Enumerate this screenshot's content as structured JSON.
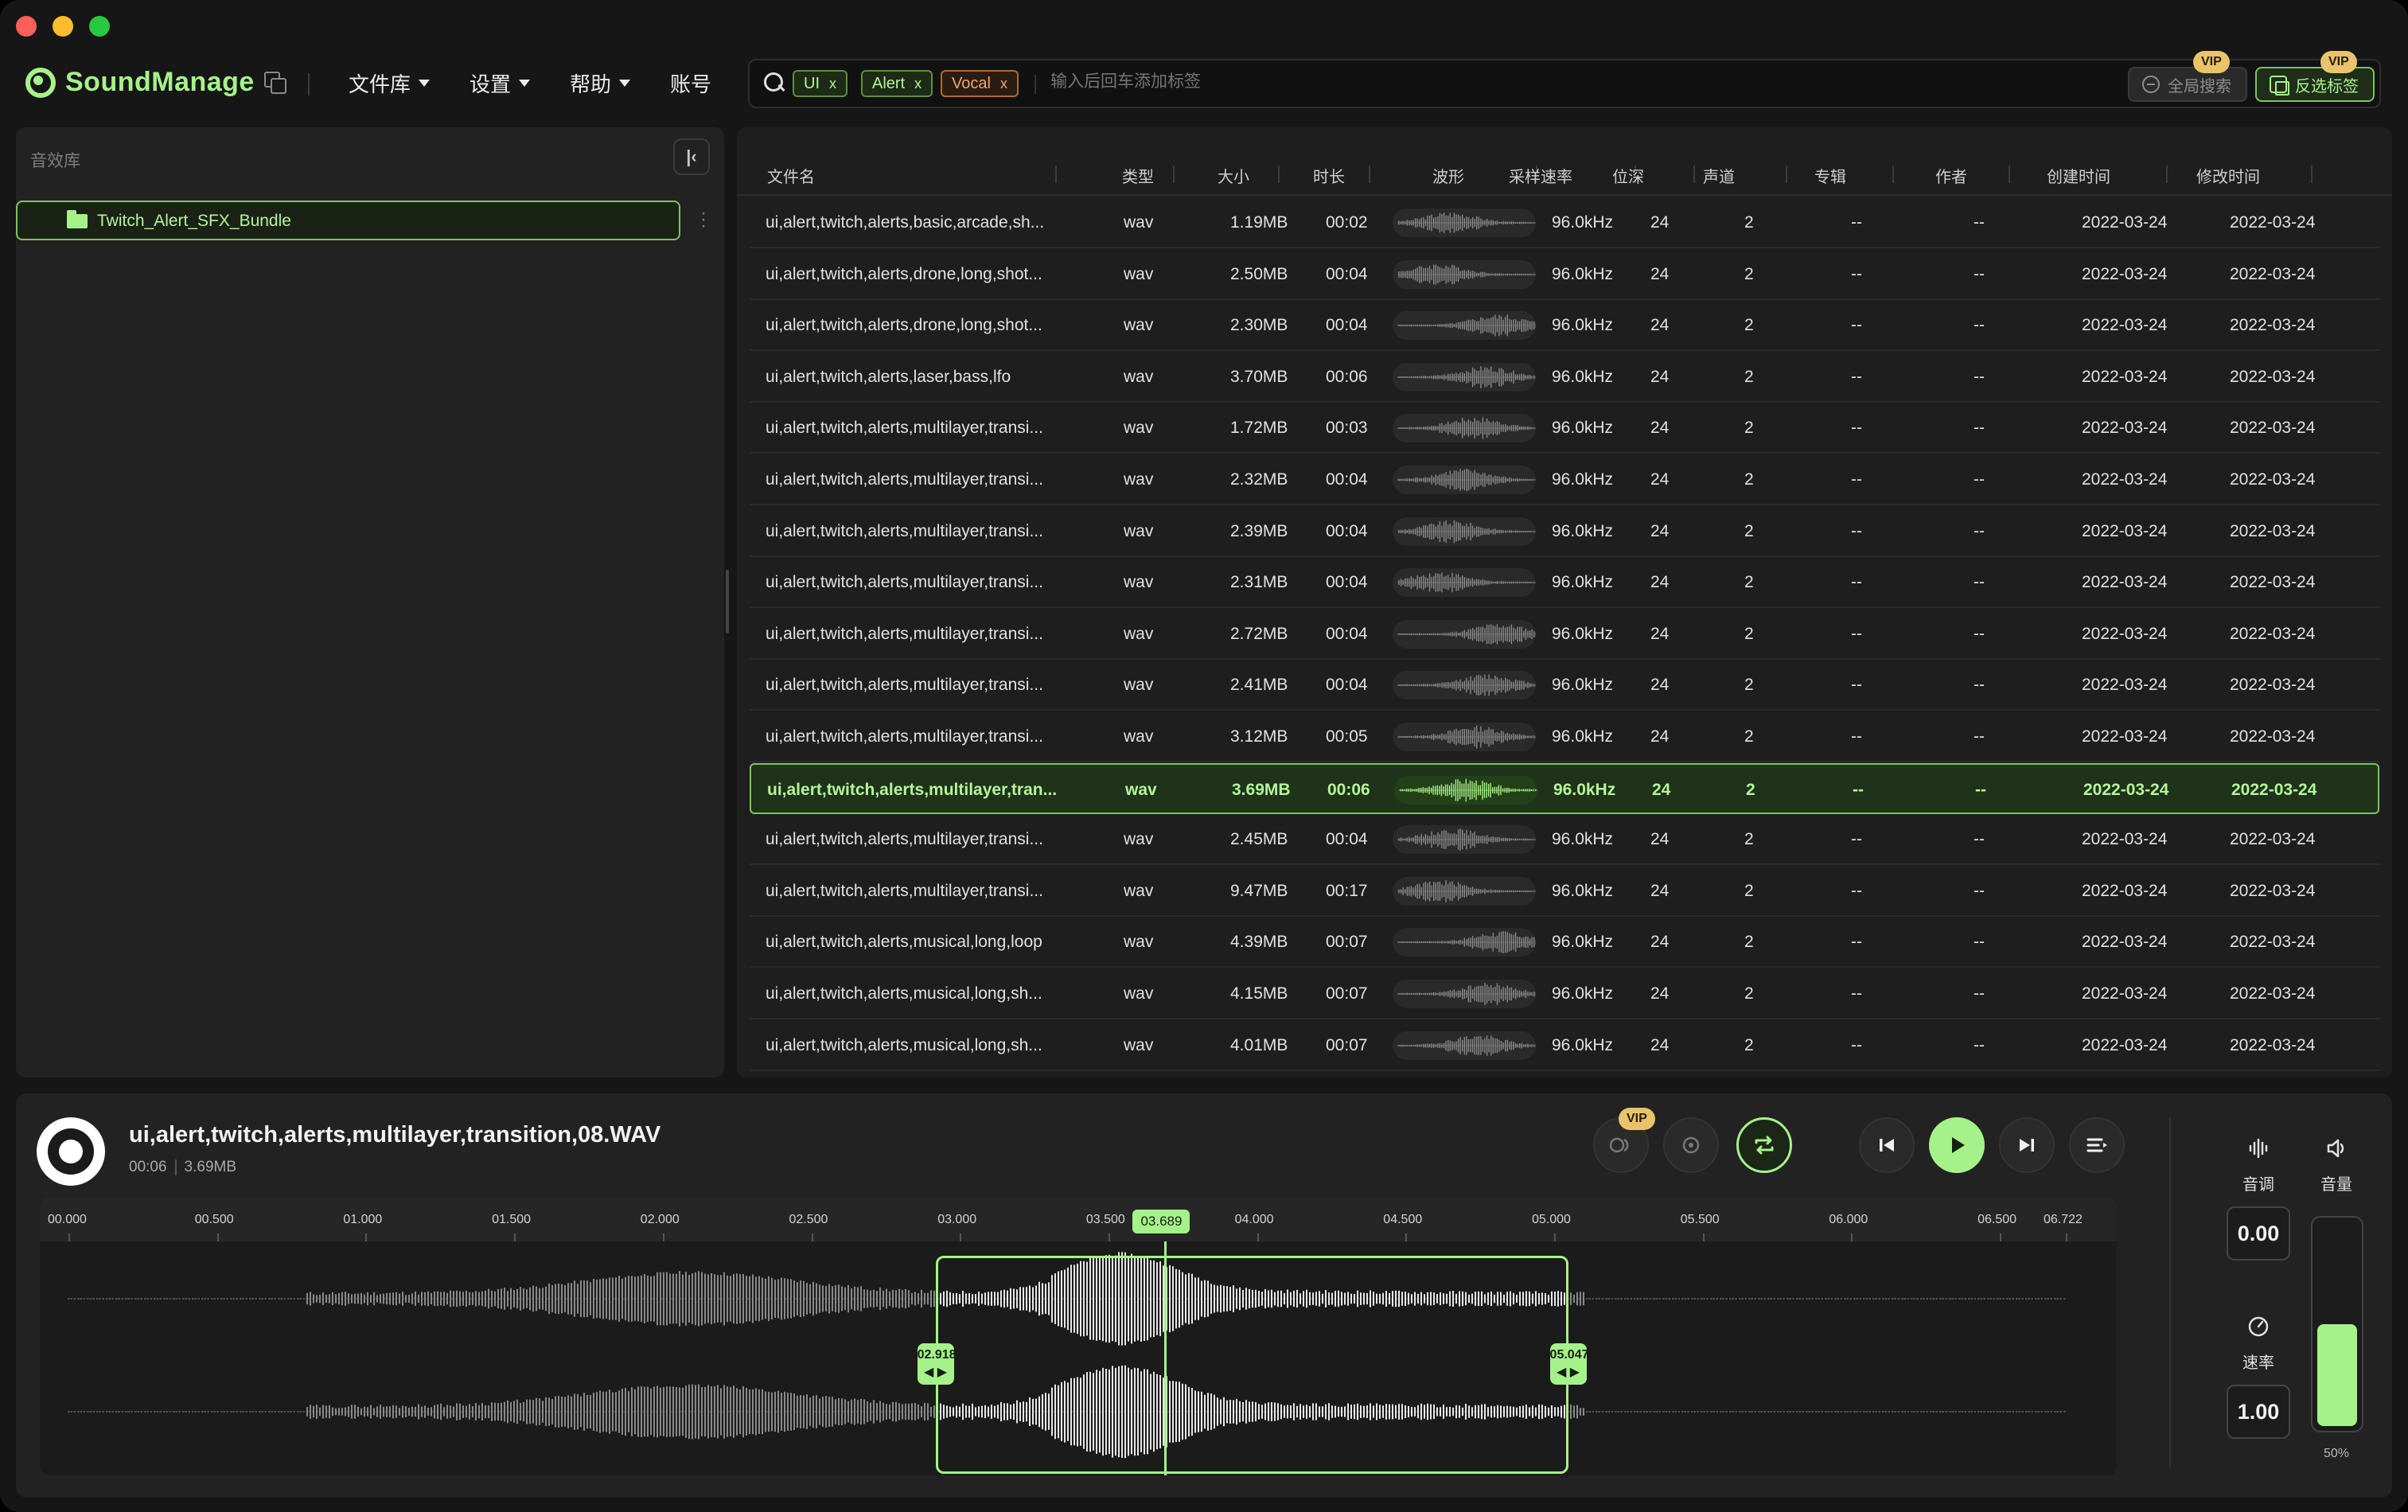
{
  "app": {
    "name": "SoundManage"
  },
  "menu": {
    "library": "文件库",
    "settings": "设置",
    "help": "帮助",
    "account": "账号"
  },
  "search": {
    "tags": [
      {
        "label": "UI",
        "x": "x",
        "color": "#b6f49a"
      },
      {
        "label": "Alert",
        "x": "x",
        "color": "#b6f49a"
      },
      {
        "label": "Vocal",
        "x": "x",
        "color": "#f2a66d"
      }
    ],
    "placeholder": "输入后回车添加标签",
    "global_search": "全局搜索",
    "invert_tags": "反选标签",
    "vip": "VIP"
  },
  "sidebar": {
    "title": "音效库",
    "folder": "Twitch_Alert_SFX_Bundle"
  },
  "table": {
    "headers": [
      "文件名",
      "类型",
      "大小",
      "时长",
      "波形",
      "采样速率",
      "位深",
      "声道",
      "专辑",
      "作者",
      "创建时间",
      "修改时间"
    ],
    "rows": [
      [
        "ui,alert,twitch,alerts,basic,arcade,sh...",
        "wav",
        "1.19MB",
        "00:02",
        "96.0kHz",
        "24",
        "2",
        "--",
        "--",
        "2022-03-24",
        "2022-03-24"
      ],
      [
        "ui,alert,twitch,alerts,drone,long,shot...",
        "wav",
        "2.50MB",
        "00:04",
        "96.0kHz",
        "24",
        "2",
        "--",
        "--",
        "2022-03-24",
        "2022-03-24"
      ],
      [
        "ui,alert,twitch,alerts,drone,long,shot...",
        "wav",
        "2.30MB",
        "00:04",
        "96.0kHz",
        "24",
        "2",
        "--",
        "--",
        "2022-03-24",
        "2022-03-24"
      ],
      [
        "ui,alert,twitch,alerts,laser,bass,lfo",
        "wav",
        "3.70MB",
        "00:06",
        "96.0kHz",
        "24",
        "2",
        "--",
        "--",
        "2022-03-24",
        "2022-03-24"
      ],
      [
        "ui,alert,twitch,alerts,multilayer,transi...",
        "wav",
        "1.72MB",
        "00:03",
        "96.0kHz",
        "24",
        "2",
        "--",
        "--",
        "2022-03-24",
        "2022-03-24"
      ],
      [
        "ui,alert,twitch,alerts,multilayer,transi...",
        "wav",
        "2.32MB",
        "00:04",
        "96.0kHz",
        "24",
        "2",
        "--",
        "--",
        "2022-03-24",
        "2022-03-24"
      ],
      [
        "ui,alert,twitch,alerts,multilayer,transi...",
        "wav",
        "2.39MB",
        "00:04",
        "96.0kHz",
        "24",
        "2",
        "--",
        "--",
        "2022-03-24",
        "2022-03-24"
      ],
      [
        "ui,alert,twitch,alerts,multilayer,transi...",
        "wav",
        "2.31MB",
        "00:04",
        "96.0kHz",
        "24",
        "2",
        "--",
        "--",
        "2022-03-24",
        "2022-03-24"
      ],
      [
        "ui,alert,twitch,alerts,multilayer,transi...",
        "wav",
        "2.72MB",
        "00:04",
        "96.0kHz",
        "24",
        "2",
        "--",
        "--",
        "2022-03-24",
        "2022-03-24"
      ],
      [
        "ui,alert,twitch,alerts,multilayer,transi...",
        "wav",
        "2.41MB",
        "00:04",
        "96.0kHz",
        "24",
        "2",
        "--",
        "--",
        "2022-03-24",
        "2022-03-24"
      ],
      [
        "ui,alert,twitch,alerts,multilayer,transi...",
        "wav",
        "3.12MB",
        "00:05",
        "96.0kHz",
        "24",
        "2",
        "--",
        "--",
        "2022-03-24",
        "2022-03-24"
      ],
      [
        "ui,alert,twitch,alerts,multilayer,tran...",
        "wav",
        "3.69MB",
        "00:06",
        "96.0kHz",
        "24",
        "2",
        "--",
        "--",
        "2022-03-24",
        "2022-03-24"
      ],
      [
        "ui,alert,twitch,alerts,multilayer,transi...",
        "wav",
        "2.45MB",
        "00:04",
        "96.0kHz",
        "24",
        "2",
        "--",
        "--",
        "2022-03-24",
        "2022-03-24"
      ],
      [
        "ui,alert,twitch,alerts,multilayer,transi...",
        "wav",
        "9.47MB",
        "00:17",
        "96.0kHz",
        "24",
        "2",
        "--",
        "--",
        "2022-03-24",
        "2022-03-24"
      ],
      [
        "ui,alert,twitch,alerts,musical,long,loop",
        "wav",
        "4.39MB",
        "00:07",
        "96.0kHz",
        "24",
        "2",
        "--",
        "--",
        "2022-03-24",
        "2022-03-24"
      ],
      [
        "ui,alert,twitch,alerts,musical,long,sh...",
        "wav",
        "4.15MB",
        "00:07",
        "96.0kHz",
        "24",
        "2",
        "--",
        "--",
        "2022-03-24",
        "2022-03-24"
      ],
      [
        "ui,alert,twitch,alerts,musical,long,sh...",
        "wav",
        "4.01MB",
        "00:07",
        "96.0kHz",
        "24",
        "2",
        "--",
        "--",
        "2022-03-24",
        "2022-03-24"
      ]
    ],
    "selected_index": 11
  },
  "player": {
    "title": "ui,alert,twitch,alerts,multilayer,transition,08.WAV",
    "duration": "00:06",
    "size": "3.69MB",
    "vip": "VIP",
    "ruler": [
      "00.000",
      "00.500",
      "01.000",
      "01.500",
      "02.000",
      "02.500",
      "03.000",
      "03.500",
      "04.000",
      "04.500",
      "05.000",
      "05.500",
      "06.000",
      "06.500",
      "06.722"
    ],
    "ruler_seconds": [
      0,
      0.5,
      1,
      1.5,
      2,
      2.5,
      3,
      3.5,
      4,
      4.5,
      5,
      5.5,
      6,
      6.5,
      6.722
    ],
    "total_seconds": 6.722,
    "current_time": "03.689",
    "current_seconds": 3.689,
    "selection_start": "02.918",
    "selection_start_seconds": 2.918,
    "selection_end": "05.047",
    "selection_end_seconds": 5.047,
    "pitch_label": "音调",
    "pitch_value": "0.00",
    "speed_label": "速率",
    "speed_value": "1.00",
    "volume_label": "音量",
    "volume_value": "50%",
    "volume_fraction": 0.5
  },
  "colors": {
    "accent": "#a6f28a",
    "accent_dark": "#7ec35f",
    "tag_orange": "#f2a66d",
    "vip": "#e9c46a"
  }
}
